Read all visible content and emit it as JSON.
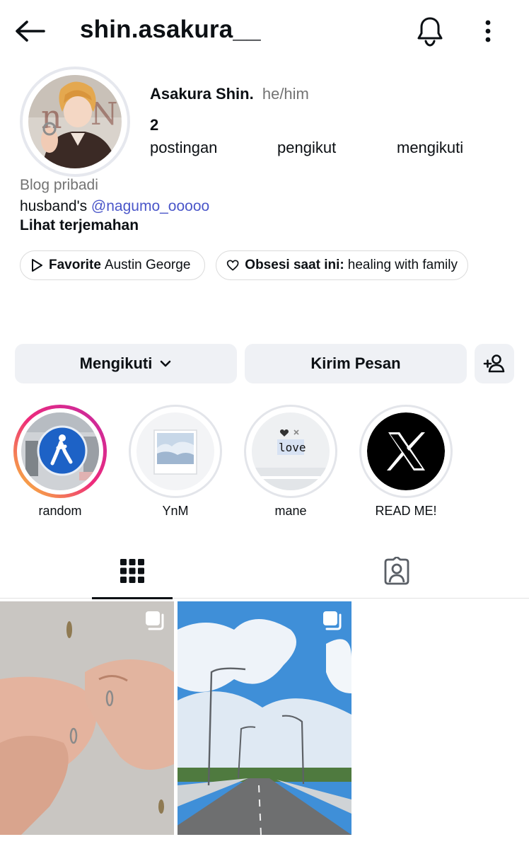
{
  "header": {
    "username": "shin.asakura__",
    "icons": {
      "back": "arrow-left-icon",
      "notifications": "bell-icon",
      "more": "more-vertical-icon"
    }
  },
  "profile": {
    "full_name": "Asakura Shin.",
    "pronouns": "he/him",
    "stats": [
      {
        "number": "2",
        "label": "postingan"
      },
      {
        "number": "",
        "label": "pengikut"
      },
      {
        "number": "",
        "label": "mengikuti"
      }
    ],
    "category": "Blog pribadi",
    "bio_prefix": "husband's ",
    "bio_mention": "@nagumo_ooooo",
    "translate_link": "Lihat terjemahan",
    "chips": [
      {
        "icon": "play-icon",
        "bold": "Favorite",
        "text": "Austin George"
      },
      {
        "icon": "heart-icon",
        "bold": "Obsesi saat ini:",
        "text": "healing with family"
      }
    ]
  },
  "actions": {
    "following_label": "Mengikuti",
    "message_label": "Kirim Pesan",
    "add_icon": "add-person-icon"
  },
  "highlights": [
    {
      "label": "random",
      "unseen": true
    },
    {
      "label": "YnM",
      "unseen": false
    },
    {
      "label": "mane",
      "unseen": false,
      "inner_text": "love"
    },
    {
      "label": "READ ME!",
      "unseen": false
    }
  ],
  "tabs": [
    {
      "name": "posts",
      "icon": "grid-icon",
      "active": true
    },
    {
      "name": "tagged",
      "icon": "tagged-user-icon",
      "active": false
    }
  ],
  "posts": [
    {
      "subject": "hands-with-rings",
      "icon": "multiple-posts-icon"
    },
    {
      "subject": "sky-road",
      "icon": "multiple-posts-icon"
    }
  ],
  "colors": {
    "mention": "#4a56c9",
    "button_bg": "#eff1f5",
    "muted": "#737373"
  }
}
